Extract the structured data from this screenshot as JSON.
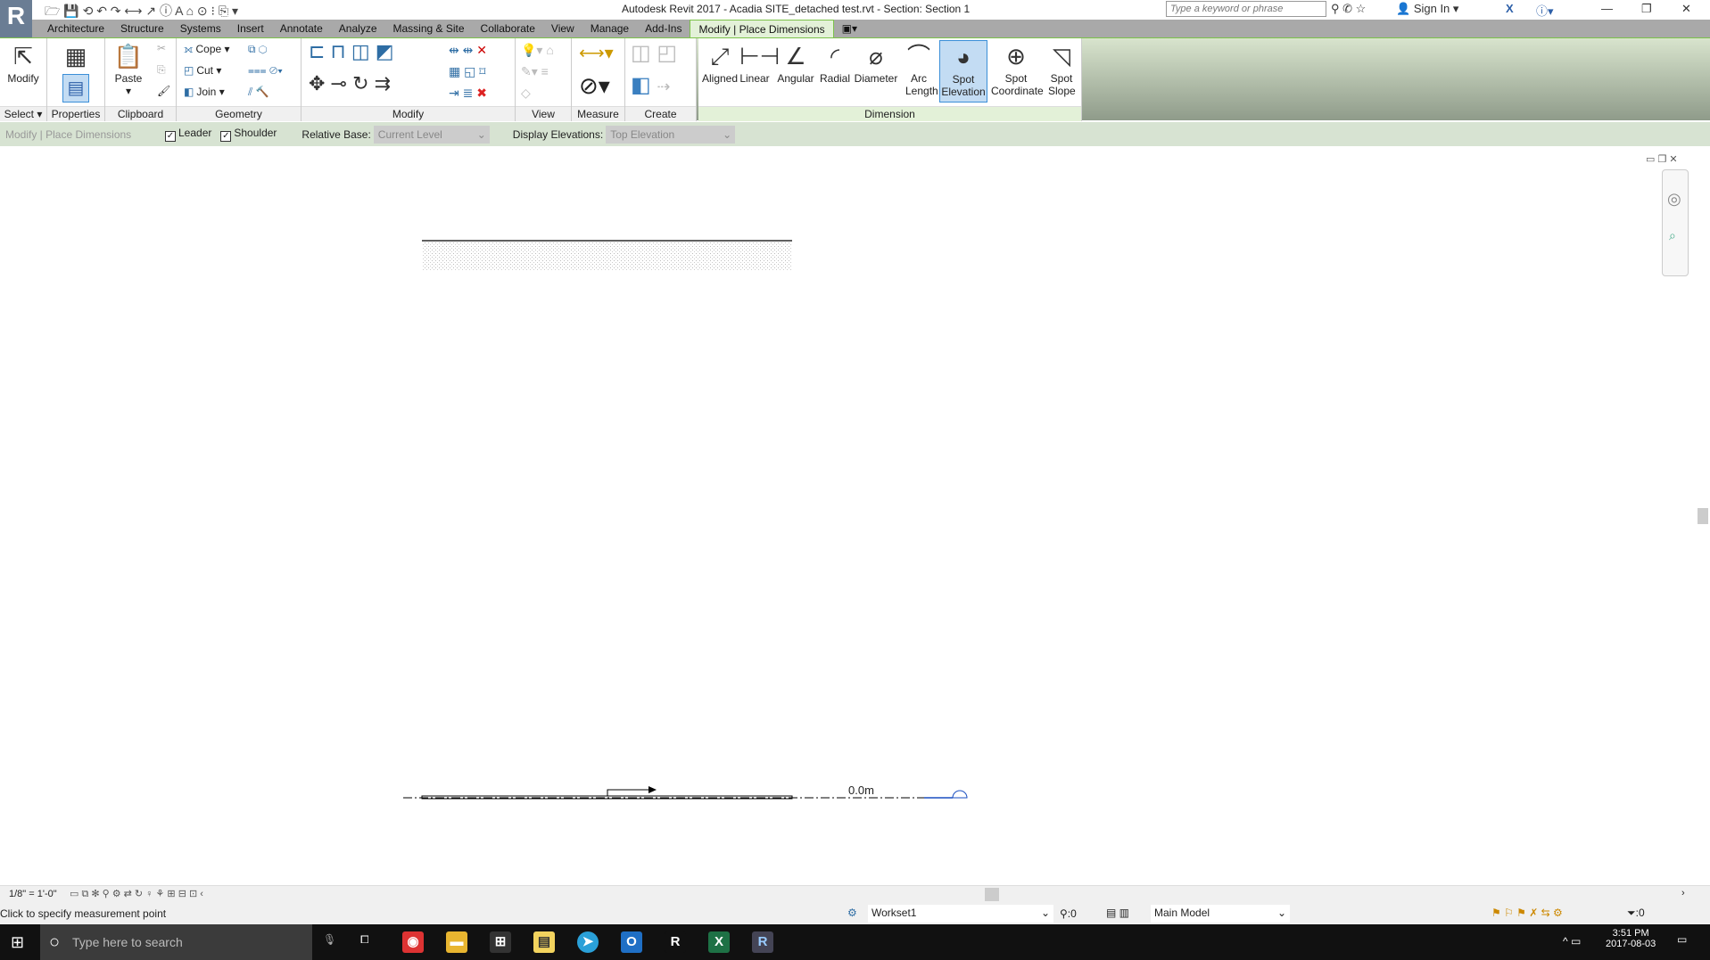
{
  "window": {
    "title": "Autodesk Revit 2017 -    Acadia SITE_detached test.rvt - Section: Section 1",
    "search_placeholder": "Type a keyword or phrase",
    "sign_in": "Sign In",
    "logo": "R"
  },
  "tabs": [
    "Architecture",
    "Structure",
    "Systems",
    "Insert",
    "Annotate",
    "Analyze",
    "Massing & Site",
    "Collaborate",
    "View",
    "Manage",
    "Add-Ins",
    "Modify | Place Dimensions"
  ],
  "ribbon": {
    "select": {
      "button": "Modify",
      "label": "Select"
    },
    "properties": {
      "label": "Properties"
    },
    "clipboard": {
      "button": "Paste",
      "label": "Clipboard"
    },
    "geometry": {
      "cope": "Cope",
      "cut": "Cut",
      "join": "Join",
      "label": "Geometry"
    },
    "modify": {
      "label": "Modify"
    },
    "view": {
      "label": "View"
    },
    "measure": {
      "label": "Measure"
    },
    "create": {
      "label": "Create"
    },
    "dimension": {
      "label": "Dimension",
      "buttons": [
        "Aligned",
        "Linear",
        "Angular",
        "Radial",
        "Diameter",
        "Arc Length",
        "Spot Elevation",
        "Spot Coordinate",
        "Spot Slope"
      ],
      "active": "Spot Elevation"
    }
  },
  "options": {
    "context": "Modify | Place Dimensions",
    "leader": "Leader",
    "shoulder": "Shoulder",
    "relative_base_label": "Relative Base:",
    "relative_base_value": "Current Level",
    "display_elev_label": "Display Elevations:",
    "display_elev_value": "Top Elevation",
    "leader_checked": true,
    "shoulder_checked": true
  },
  "canvas": {
    "elevation_text": "0.0m"
  },
  "viewbar": {
    "scale": "1/8\" = 1'-0\""
  },
  "status": {
    "message": "Click to specify measurement point",
    "workset": "Workset1",
    "worksets_count": ":0",
    "design_option": "Main Model",
    "filter_count": ":0"
  },
  "taskbar": {
    "search_placeholder": "Type here to search",
    "time": "3:51 PM",
    "date": "2017-08-03"
  }
}
